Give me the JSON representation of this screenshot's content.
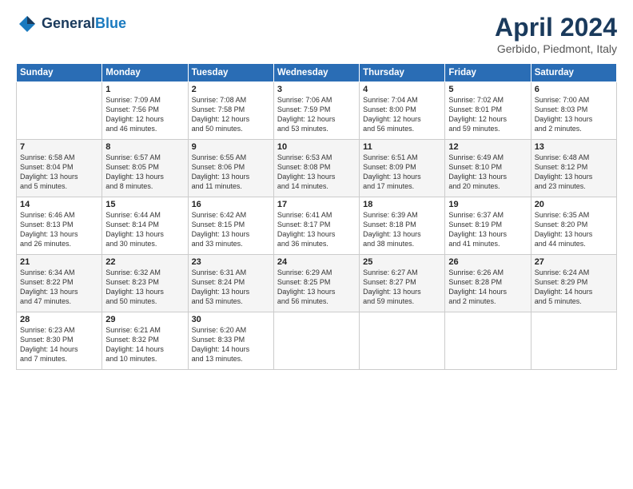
{
  "header": {
    "logo_general": "General",
    "logo_blue": "Blue",
    "month_title": "April 2024",
    "location": "Gerbido, Piedmont, Italy"
  },
  "weekdays": [
    "Sunday",
    "Monday",
    "Tuesday",
    "Wednesday",
    "Thursday",
    "Friday",
    "Saturday"
  ],
  "weeks": [
    [
      {
        "day": "",
        "info": ""
      },
      {
        "day": "1",
        "info": "Sunrise: 7:09 AM\nSunset: 7:56 PM\nDaylight: 12 hours\nand 46 minutes."
      },
      {
        "day": "2",
        "info": "Sunrise: 7:08 AM\nSunset: 7:58 PM\nDaylight: 12 hours\nand 50 minutes."
      },
      {
        "day": "3",
        "info": "Sunrise: 7:06 AM\nSunset: 7:59 PM\nDaylight: 12 hours\nand 53 minutes."
      },
      {
        "day": "4",
        "info": "Sunrise: 7:04 AM\nSunset: 8:00 PM\nDaylight: 12 hours\nand 56 minutes."
      },
      {
        "day": "5",
        "info": "Sunrise: 7:02 AM\nSunset: 8:01 PM\nDaylight: 12 hours\nand 59 minutes."
      },
      {
        "day": "6",
        "info": "Sunrise: 7:00 AM\nSunset: 8:03 PM\nDaylight: 13 hours\nand 2 minutes."
      }
    ],
    [
      {
        "day": "7",
        "info": "Sunrise: 6:58 AM\nSunset: 8:04 PM\nDaylight: 13 hours\nand 5 minutes."
      },
      {
        "day": "8",
        "info": "Sunrise: 6:57 AM\nSunset: 8:05 PM\nDaylight: 13 hours\nand 8 minutes."
      },
      {
        "day": "9",
        "info": "Sunrise: 6:55 AM\nSunset: 8:06 PM\nDaylight: 13 hours\nand 11 minutes."
      },
      {
        "day": "10",
        "info": "Sunrise: 6:53 AM\nSunset: 8:08 PM\nDaylight: 13 hours\nand 14 minutes."
      },
      {
        "day": "11",
        "info": "Sunrise: 6:51 AM\nSunset: 8:09 PM\nDaylight: 13 hours\nand 17 minutes."
      },
      {
        "day": "12",
        "info": "Sunrise: 6:49 AM\nSunset: 8:10 PM\nDaylight: 13 hours\nand 20 minutes."
      },
      {
        "day": "13",
        "info": "Sunrise: 6:48 AM\nSunset: 8:12 PM\nDaylight: 13 hours\nand 23 minutes."
      }
    ],
    [
      {
        "day": "14",
        "info": "Sunrise: 6:46 AM\nSunset: 8:13 PM\nDaylight: 13 hours\nand 26 minutes."
      },
      {
        "day": "15",
        "info": "Sunrise: 6:44 AM\nSunset: 8:14 PM\nDaylight: 13 hours\nand 30 minutes."
      },
      {
        "day": "16",
        "info": "Sunrise: 6:42 AM\nSunset: 8:15 PM\nDaylight: 13 hours\nand 33 minutes."
      },
      {
        "day": "17",
        "info": "Sunrise: 6:41 AM\nSunset: 8:17 PM\nDaylight: 13 hours\nand 36 minutes."
      },
      {
        "day": "18",
        "info": "Sunrise: 6:39 AM\nSunset: 8:18 PM\nDaylight: 13 hours\nand 38 minutes."
      },
      {
        "day": "19",
        "info": "Sunrise: 6:37 AM\nSunset: 8:19 PM\nDaylight: 13 hours\nand 41 minutes."
      },
      {
        "day": "20",
        "info": "Sunrise: 6:35 AM\nSunset: 8:20 PM\nDaylight: 13 hours\nand 44 minutes."
      }
    ],
    [
      {
        "day": "21",
        "info": "Sunrise: 6:34 AM\nSunset: 8:22 PM\nDaylight: 13 hours\nand 47 minutes."
      },
      {
        "day": "22",
        "info": "Sunrise: 6:32 AM\nSunset: 8:23 PM\nDaylight: 13 hours\nand 50 minutes."
      },
      {
        "day": "23",
        "info": "Sunrise: 6:31 AM\nSunset: 8:24 PM\nDaylight: 13 hours\nand 53 minutes."
      },
      {
        "day": "24",
        "info": "Sunrise: 6:29 AM\nSunset: 8:25 PM\nDaylight: 13 hours\nand 56 minutes."
      },
      {
        "day": "25",
        "info": "Sunrise: 6:27 AM\nSunset: 8:27 PM\nDaylight: 13 hours\nand 59 minutes."
      },
      {
        "day": "26",
        "info": "Sunrise: 6:26 AM\nSunset: 8:28 PM\nDaylight: 14 hours\nand 2 minutes."
      },
      {
        "day": "27",
        "info": "Sunrise: 6:24 AM\nSunset: 8:29 PM\nDaylight: 14 hours\nand 5 minutes."
      }
    ],
    [
      {
        "day": "28",
        "info": "Sunrise: 6:23 AM\nSunset: 8:30 PM\nDaylight: 14 hours\nand 7 minutes."
      },
      {
        "day": "29",
        "info": "Sunrise: 6:21 AM\nSunset: 8:32 PM\nDaylight: 14 hours\nand 10 minutes."
      },
      {
        "day": "30",
        "info": "Sunrise: 6:20 AM\nSunset: 8:33 PM\nDaylight: 14 hours\nand 13 minutes."
      },
      {
        "day": "",
        "info": ""
      },
      {
        "day": "",
        "info": ""
      },
      {
        "day": "",
        "info": ""
      },
      {
        "day": "",
        "info": ""
      }
    ]
  ]
}
